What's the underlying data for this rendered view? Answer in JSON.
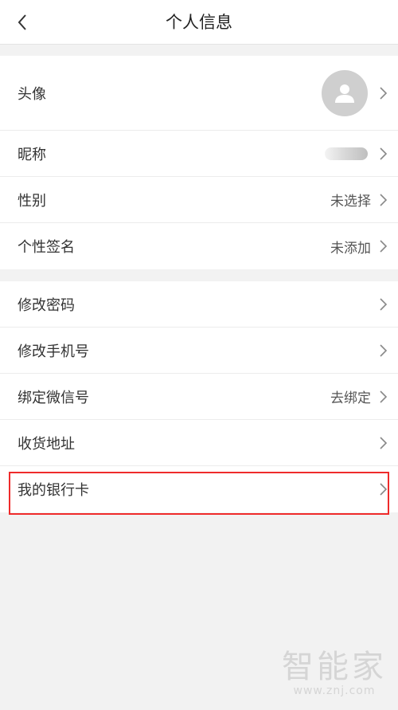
{
  "header": {
    "title": "个人信息",
    "back_icon": "chevron-left-icon"
  },
  "profile_group": [
    {
      "label": "头像",
      "value": "",
      "type": "avatar"
    },
    {
      "label": "昵称",
      "value": "",
      "type": "blurred"
    },
    {
      "label": "性别",
      "value": "未选择"
    },
    {
      "label": "个性签名",
      "value": "未添加"
    }
  ],
  "account_group": [
    {
      "label": "修改密码",
      "value": ""
    },
    {
      "label": "修改手机号",
      "value": ""
    },
    {
      "label": "绑定微信号",
      "value": "去绑定"
    },
    {
      "label": "收货地址",
      "value": ""
    },
    {
      "label": "我的银行卡",
      "value": "",
      "highlighted": true
    }
  ],
  "highlight_color": "#ef2b2b",
  "watermark": {
    "brand": "智能家",
    "url": "www.znj.com"
  }
}
